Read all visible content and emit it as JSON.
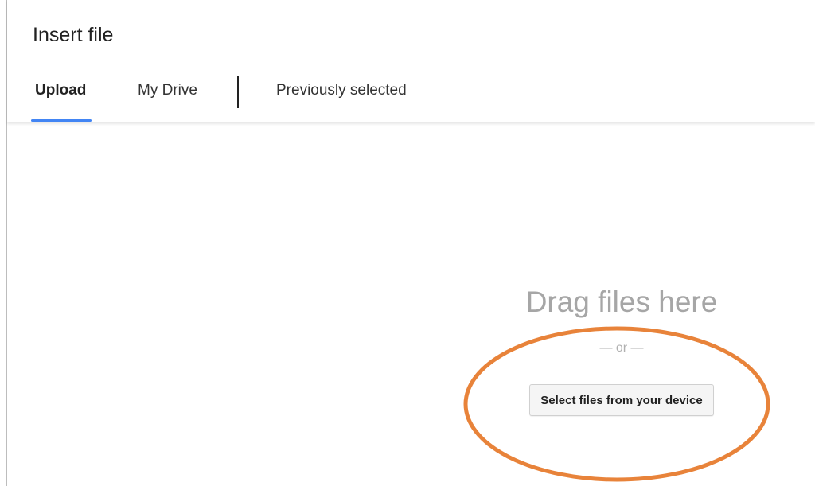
{
  "dialog": {
    "title": "Insert file"
  },
  "tabs": [
    {
      "label": "Upload",
      "active": true
    },
    {
      "label": "My Drive",
      "active": false
    },
    {
      "label": "Previously selected",
      "active": false
    }
  ],
  "upload": {
    "drag_text": "Drag files here",
    "or_text": "— or —",
    "select_button_label": "Select files from your device"
  },
  "colors": {
    "tab_indicator": "#4285f4",
    "annotation_circle": "#e8833a"
  }
}
